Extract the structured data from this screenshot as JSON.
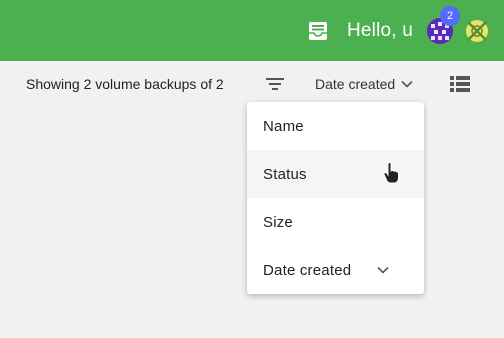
{
  "header": {
    "greeting": "Hello, u",
    "notification_count": "2",
    "colors": {
      "bar": "#4caf50",
      "badge": "#5469ff"
    },
    "icons": [
      "inbox-icon",
      "avatar",
      "organization-icon"
    ]
  },
  "toolbar": {
    "summary": "Showing 2 volume backups of 2",
    "sort_label": "Date created",
    "icons": [
      "filter-icon",
      "chevron-down-icon",
      "list-view-icon"
    ]
  },
  "sort_menu": {
    "items": [
      {
        "label": "Name"
      },
      {
        "label": "Status"
      },
      {
        "label": "Size"
      },
      {
        "label": "Date created"
      }
    ]
  }
}
